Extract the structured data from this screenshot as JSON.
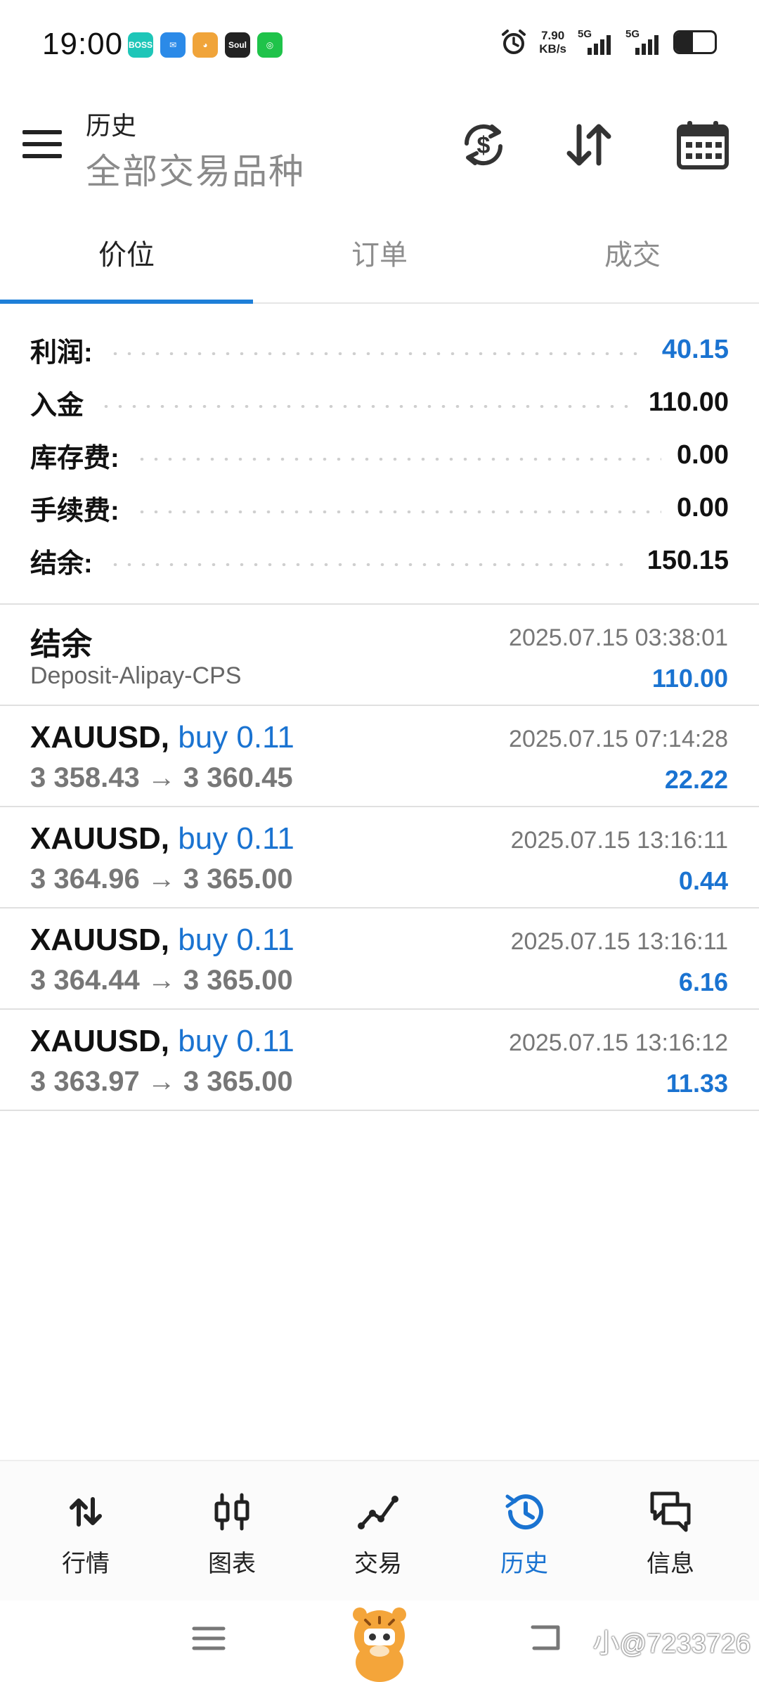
{
  "status_bar": {
    "time": "19:00",
    "apps": [
      {
        "name": "boss-app-icon",
        "text": "BOSS",
        "color": "#1ec6b8"
      },
      {
        "name": "mail-app-icon",
        "text": "✉",
        "color": "#2b8ae8"
      },
      {
        "name": "tiger-app-icon",
        "text": "◕",
        "color": "#f0a43a"
      },
      {
        "name": "soul-app-icon",
        "text": "Soul",
        "color": "#222222"
      },
      {
        "name": "wechat-app-icon",
        "text": "◎",
        "color": "#1fc34a"
      }
    ],
    "net_speed_value": "7.90",
    "net_speed_unit": "KB/s",
    "signal_1": "5G",
    "signal_2": "5G",
    "battery_level": 0.45
  },
  "header": {
    "title": "历史",
    "subtitle": "全部交易品种"
  },
  "tabs": [
    {
      "label": "价位",
      "active": true
    },
    {
      "label": "订单",
      "active": false
    },
    {
      "label": "成交",
      "active": false
    }
  ],
  "summary": [
    {
      "label": "利润:",
      "value": "40.15",
      "highlight": true
    },
    {
      "label": "入金",
      "value": "110.00",
      "highlight": false
    },
    {
      "label": "库存费:",
      "value": "0.00",
      "highlight": false
    },
    {
      "label": "手续费:",
      "value": "0.00",
      "highlight": false
    },
    {
      "label": "结余:",
      "value": "150.15",
      "highlight": false
    }
  ],
  "balance_entry": {
    "title": "结余",
    "comment": "Deposit-Alipay-CPS",
    "time": "2025.07.15 03:38:01",
    "amount": "110.00"
  },
  "deals": [
    {
      "symbol": "XAUUSD,",
      "direction": "buy 0.11",
      "prices": "3 358.43 → 3 360.45",
      "time": "2025.07.15 07:14:28",
      "profit": "22.22"
    },
    {
      "symbol": "XAUUSD,",
      "direction": "buy 0.11",
      "prices": "3 364.96 → 3 365.00",
      "time": "2025.07.15 13:16:11",
      "profit": "0.44"
    },
    {
      "symbol": "XAUUSD,",
      "direction": "buy 0.11",
      "prices": "3 364.44 → 3 365.00",
      "time": "2025.07.15 13:16:11",
      "profit": "6.16"
    },
    {
      "symbol": "XAUUSD,",
      "direction": "buy 0.11",
      "prices": "3 363.97 → 3 365.00",
      "time": "2025.07.15 13:16:12",
      "profit": "11.33"
    }
  ],
  "bottom_nav": [
    {
      "label": "行情",
      "icon": "quotes-icon",
      "active": false
    },
    {
      "label": "图表",
      "icon": "chart-icon",
      "active": false
    },
    {
      "label": "交易",
      "icon": "trade-icon",
      "active": false
    },
    {
      "label": "历史",
      "icon": "history-icon",
      "active": true
    },
    {
      "label": "信息",
      "icon": "messages-icon",
      "active": false
    }
  ],
  "watermark": "小@7233726",
  "colors": {
    "accent": "#1a73d1",
    "tab_indicator": "#1e7fd8"
  }
}
